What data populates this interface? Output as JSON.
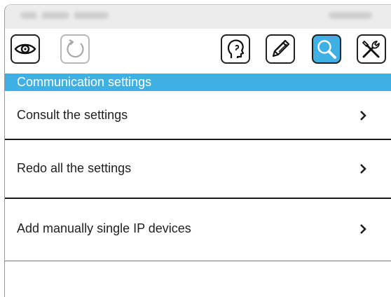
{
  "toolbar": {
    "buttons": [
      {
        "icon": "eye-icon",
        "state": "normal"
      },
      {
        "icon": "refresh-icon",
        "state": "disabled"
      },
      {
        "icon": "head-icon",
        "state": "normal"
      },
      {
        "icon": "pencil-icon",
        "state": "normal"
      },
      {
        "icon": "search-icon",
        "state": "active"
      },
      {
        "icon": "tools-icon",
        "state": "normal"
      }
    ]
  },
  "section": {
    "title": "Communication settings"
  },
  "menu": {
    "items": [
      {
        "label": "Consult the settings",
        "icon": "chevron-right-icon"
      },
      {
        "label": "Redo all the settings",
        "icon": "chevron-right-icon"
      },
      {
        "label": "Add manually single IP devices",
        "icon": "chevron-right-icon"
      }
    ]
  },
  "colors": {
    "accent": "#3fb0e3",
    "text": "#1f1f1f",
    "header_text": "#ffffff"
  }
}
